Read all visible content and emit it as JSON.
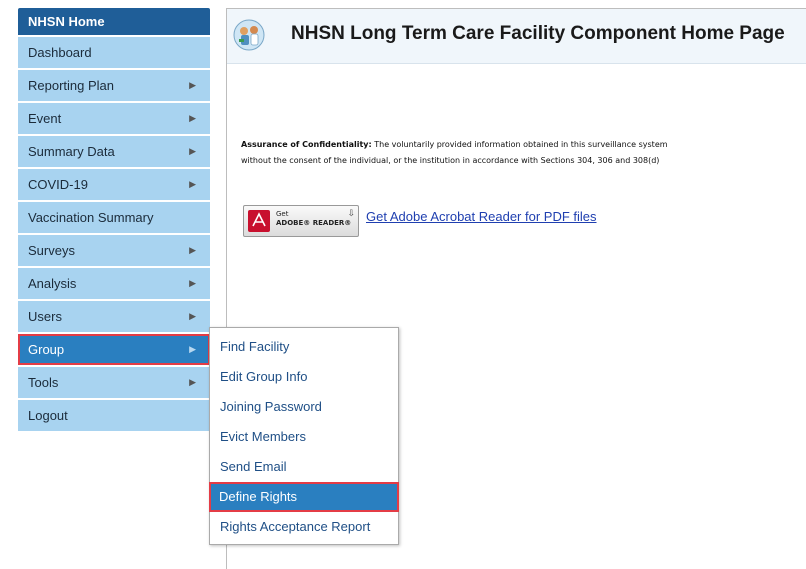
{
  "sidebar": {
    "home_label": "NHSN Home",
    "items": [
      {
        "label": "Dashboard",
        "arrow": ""
      },
      {
        "label": "Reporting Plan",
        "arrow": "▶"
      },
      {
        "label": "Event",
        "arrow": "▶"
      },
      {
        "label": "Summary Data",
        "arrow": "▶"
      },
      {
        "label": "COVID-19",
        "arrow": "▶"
      },
      {
        "label": "Vaccination Summary",
        "arrow": ""
      },
      {
        "label": "Surveys",
        "arrow": "▶"
      },
      {
        "label": "Analysis",
        "arrow": "▶"
      },
      {
        "label": "Users",
        "arrow": "▶"
      },
      {
        "label": "Group",
        "arrow": "▶"
      },
      {
        "label": "Tools",
        "arrow": "▶"
      },
      {
        "label": "Logout",
        "arrow": ""
      }
    ]
  },
  "main": {
    "title": "NHSN Long Term Care Facility Component Home Page",
    "confidentiality_label": "Assurance of Confidentiality:",
    "confidentiality_line1": "The voluntarily provided information obtained in this surveillance system",
    "confidentiality_line2": "without the consent of the individual, or the institution in accordance with Sections 304, 306 and 308(d)",
    "adobe_get": "Get",
    "adobe_reader": "ADOBE® READER®",
    "adobe_link": "Get Adobe Acrobat Reader for PDF files"
  },
  "submenu": {
    "items": [
      {
        "label": "Find Facility"
      },
      {
        "label": "Edit Group Info"
      },
      {
        "label": "Joining Password"
      },
      {
        "label": "Evict Members"
      },
      {
        "label": "Send Email"
      },
      {
        "label": "Define Rights"
      },
      {
        "label": "Rights Acceptance Report"
      }
    ]
  },
  "colors": {
    "home_bg": "#1f5e98",
    "nav_bg": "#a8d3f0",
    "active_bg": "#2a7fc0",
    "highlight_border": "#e43c46"
  }
}
